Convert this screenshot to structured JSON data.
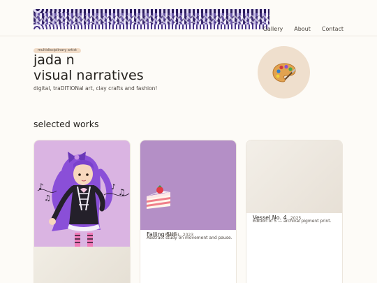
{
  "nav": {
    "items": [
      "Gallery",
      "About",
      "Contact"
    ]
  },
  "hero": {
    "tag": "multidisciplinary artist",
    "title_line1": "jada n",
    "title_line2": "visual narratives",
    "subtitle": "digital, traDITIONal art, clay crafts and fashion!"
  },
  "section": {
    "title": "selected works"
  },
  "works": [
    {
      "title": "",
      "meta": "",
      "desc": ""
    },
    {
      "title": "Falling Still",
      "meta": "PASTEL, 2023",
      "desc": "Abstract study on movement and pause."
    },
    {
      "title": "Vessel No. 4",
      "meta": "2025",
      "desc": "Edition of 5 — archival pigment print."
    }
  ],
  "icons": {
    "palette": "artist-palette-icon",
    "cake": "strawberry-cake-icon"
  },
  "colors": {
    "background": "#fdfbf7",
    "banner": "#3d2b73",
    "card2_thumb": "#b48fc6",
    "card1_thumb": "#dab4e2",
    "palette_circle": "#efdfcd"
  }
}
